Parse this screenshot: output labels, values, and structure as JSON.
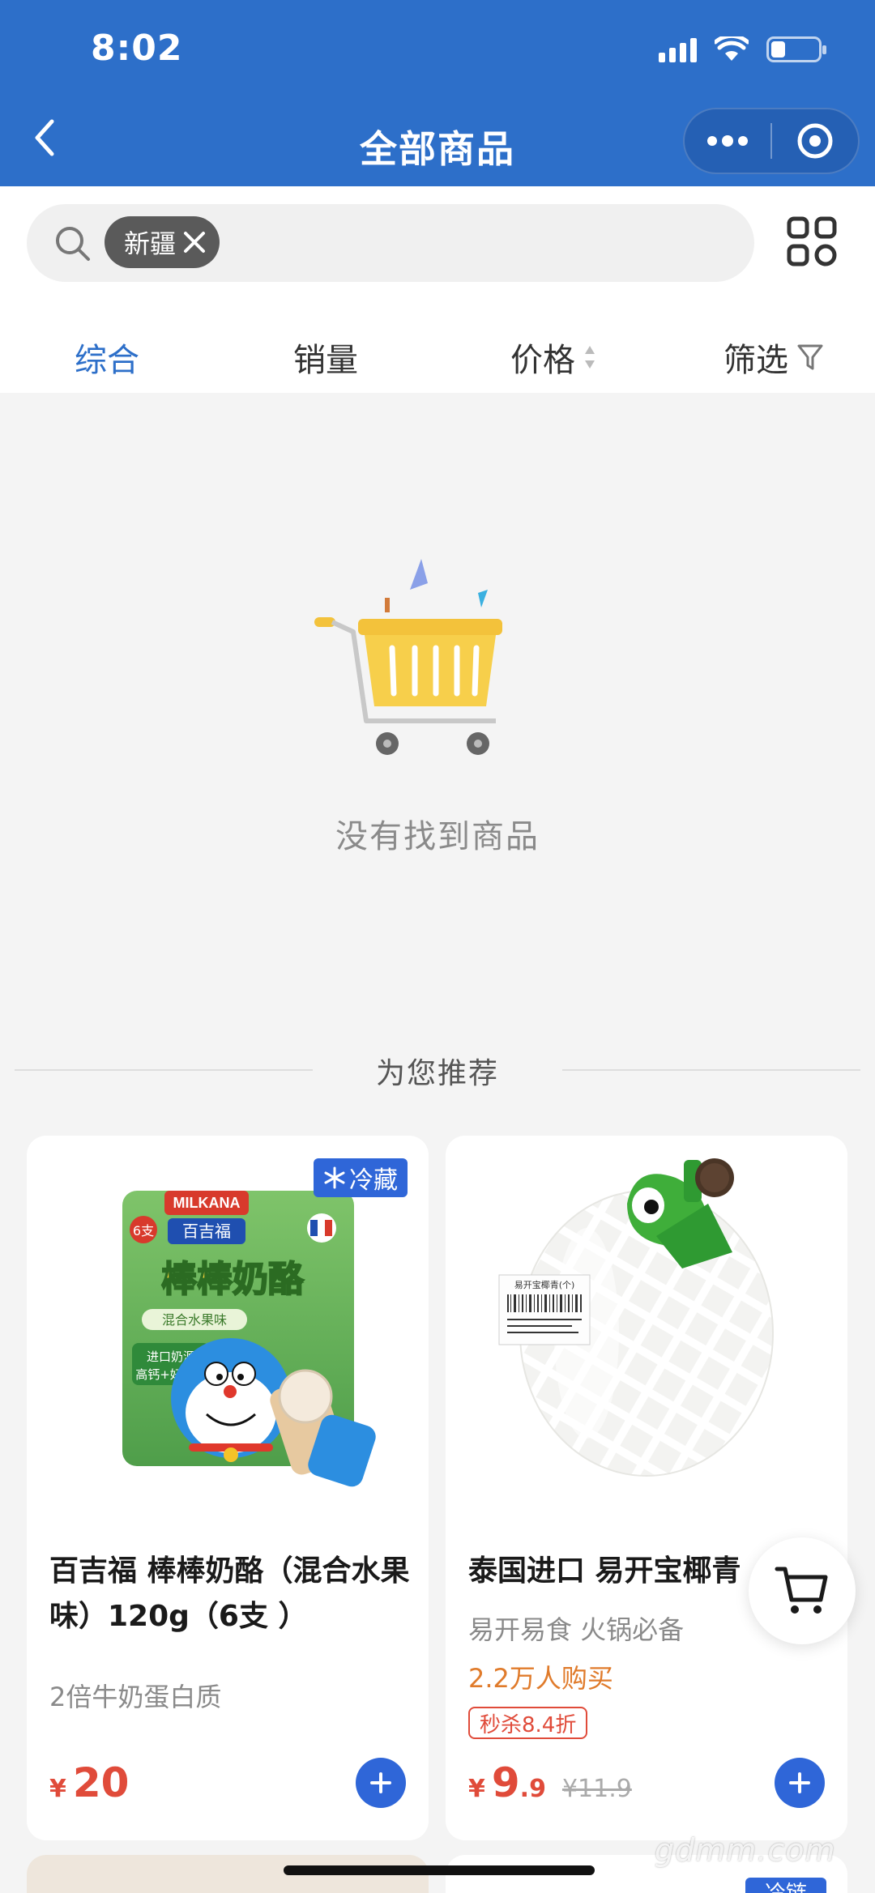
{
  "status_bar": {
    "time": "8:02"
  },
  "nav": {
    "title": "全部商品"
  },
  "search": {
    "tag": "新疆"
  },
  "sort_bar": {
    "items": [
      {
        "label": "综合",
        "active": true
      },
      {
        "label": "销量",
        "active": false
      },
      {
        "label": "价格",
        "active": false
      },
      {
        "label": "筛选",
        "active": false
      }
    ]
  },
  "empty_state": {
    "text": "没有找到商品"
  },
  "recommend": {
    "title": "为您推荐"
  },
  "products": [
    {
      "badge": "冷藏",
      "title": "百吉福 棒棒奶酪（混合水果味）120g（6支 ）",
      "subtitle": "2倍牛奶蛋白质",
      "currency": "¥",
      "price_int": "20",
      "image_text": {
        "brand": "MILKANA",
        "brand_cn": "百吉福",
        "name": "棒棒奶酪",
        "flavor": "混合水果味",
        "pack": "6支",
        "claim1": "进口奶源",
        "claim2": "高钙+好美味"
      }
    },
    {
      "title": "泰国进口 易开宝椰青",
      "subtitle": "易开易食 火锅必备",
      "sales": "2.2万人购买",
      "flash_tag": "秒杀8.4折",
      "currency": "¥",
      "price_int": "9",
      "price_dec": ".9",
      "orig_price": "¥11.9",
      "image_text": {
        "label": "易开宝椰青(个)"
      }
    }
  ],
  "next_row": {
    "badge": "冷链"
  },
  "watermark": "gdmm.com",
  "colors": {
    "brand_blue": "#2d6fc9",
    "price_red": "#e04b3a",
    "sales_orange": "#e07b2b",
    "button_blue": "#2f66d8"
  }
}
